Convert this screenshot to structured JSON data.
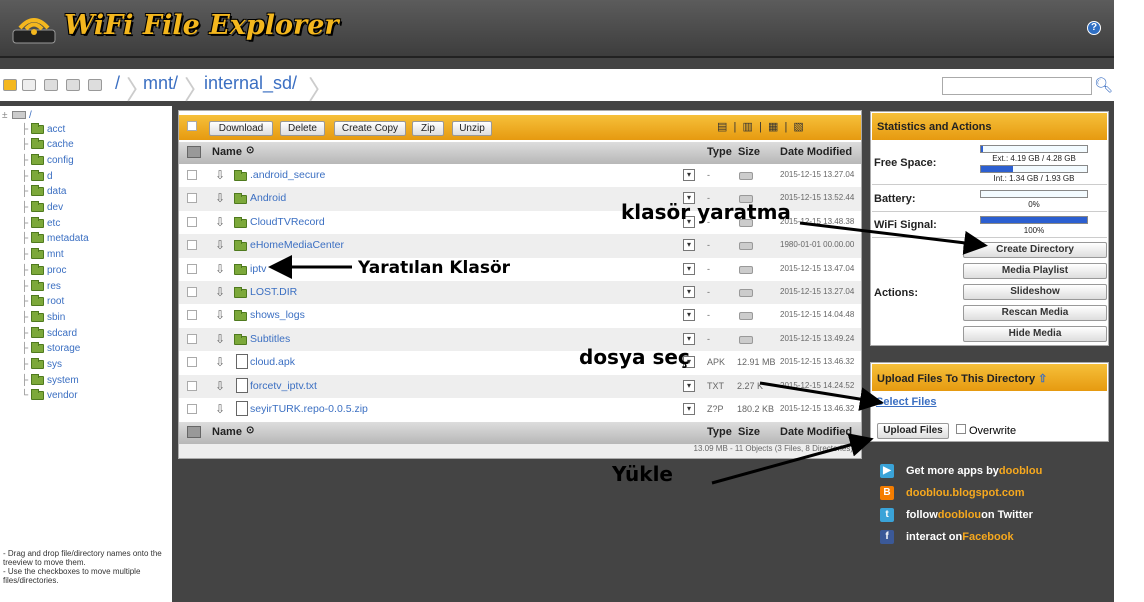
{
  "header": {
    "title": "WiFi File Explorer",
    "help_label": "?"
  },
  "breadcrumb": {
    "root": "/",
    "items": [
      "mnt/",
      "internal_sd/"
    ]
  },
  "search": {
    "placeholder": "",
    "value": ""
  },
  "tree": {
    "root": "/",
    "items": [
      "acct",
      "cache",
      "config",
      "d",
      "data",
      "dev",
      "etc",
      "metadata",
      "mnt",
      "proc",
      "res",
      "root",
      "sbin",
      "sdcard",
      "storage",
      "sys",
      "system",
      "vendor"
    ]
  },
  "hint": "- Drag and drop file/directory names onto the treeview to move them.\n- Use the checkboxes to move multiple files/directories.",
  "toolbar": {
    "download": "Download",
    "delete": "Delete",
    "create_copy": "Create Copy",
    "zip": "Zip",
    "unzip": "Unzip"
  },
  "columns": {
    "name": "Name",
    "type": "Type",
    "size": "Size",
    "date": "Date Modified"
  },
  "files": [
    {
      "name": ".android_secure",
      "type": "-",
      "size": "",
      "date": "2015-12-15 13.27.04",
      "kind": "folder"
    },
    {
      "name": "Android",
      "type": "-",
      "size": "",
      "date": "2015-12-15 13.52.44",
      "kind": "folder"
    },
    {
      "name": "CloudTVRecord",
      "type": "-",
      "size": "",
      "date": "2015-12-15 13.48.38",
      "kind": "folder"
    },
    {
      "name": "eHomeMediaCenter",
      "type": "-",
      "size": "",
      "date": "1980-01-01 00.00.00",
      "kind": "folder"
    },
    {
      "name": "iptv",
      "type": "-",
      "size": "",
      "date": "2015-12-15 13.47.04",
      "kind": "folder"
    },
    {
      "name": "LOST.DIR",
      "type": "-",
      "size": "",
      "date": "2015-12-15 13.27.04",
      "kind": "folder"
    },
    {
      "name": "shows_logs",
      "type": "-",
      "size": "",
      "date": "2015-12-15 14.04.48",
      "kind": "folder"
    },
    {
      "name": "Subtitles",
      "type": "-",
      "size": "",
      "date": "2015-12-15 13.49.24",
      "kind": "folder"
    },
    {
      "name": "cloud.apk",
      "type": "APK",
      "size": "12.91 MB",
      "date": "2015-12-15 13.46.32",
      "kind": "file"
    },
    {
      "name": "forcetv_iptv.txt",
      "type": "TXT",
      "size": "2.27 K",
      "date": "2015-12-15 14.24.52",
      "kind": "file"
    },
    {
      "name": "seyirTURK.repo-0.0.5.zip",
      "type": "Z?P",
      "size": "180.2 KB",
      "date": "2015-12-15 13.46.32",
      "kind": "file"
    }
  ],
  "summary": "13.09 MB - 11 Objects (3 Files, 8 Directories)",
  "stats": {
    "title": "Statistics and Actions",
    "free_space_label": "Free Space:",
    "ext_text": "Ext.: 4.19 GB / 4.28 GB",
    "ext_fill": 0.02,
    "int_text": "Int.: 1.34 GB / 1.93 GB",
    "int_fill": 0.3,
    "battery_label": "Battery:",
    "battery_text": "0%",
    "battery_fill": 0,
    "wifi_label": "WiFi Signal:",
    "wifi_text": "100%",
    "wifi_fill": 1,
    "actions_label": "Actions:",
    "actions": [
      "Create Directory",
      "Media Playlist",
      "Slideshow",
      "Rescan Media",
      "Hide Media"
    ]
  },
  "upload": {
    "title": "Upload Files To This Directory",
    "select": "Select Files",
    "button": "Upload Files",
    "overwrite": "Overwrite"
  },
  "social": [
    {
      "pre": "Get more apps by ",
      "hl": "dooblou",
      "post": "",
      "icon": "play-icon",
      "color": "#3aa3d8"
    },
    {
      "pre": "",
      "hl": "dooblou.blogspot.com",
      "post": "",
      "icon": "blogger-icon",
      "color": "#f57d00"
    },
    {
      "pre": "follow ",
      "hl": "dooblou",
      "post": " on Twitter",
      "icon": "twitter-icon",
      "color": "#3aa3d8"
    },
    {
      "pre": "interact on ",
      "hl": "Facebook",
      "post": "",
      "icon": "facebook-icon",
      "color": "#3b5998"
    }
  ],
  "annotations": {
    "create": "klasör yaratma",
    "created": "Yaratılan Klasör",
    "select": "dosya seç",
    "upload": "Yükle"
  }
}
